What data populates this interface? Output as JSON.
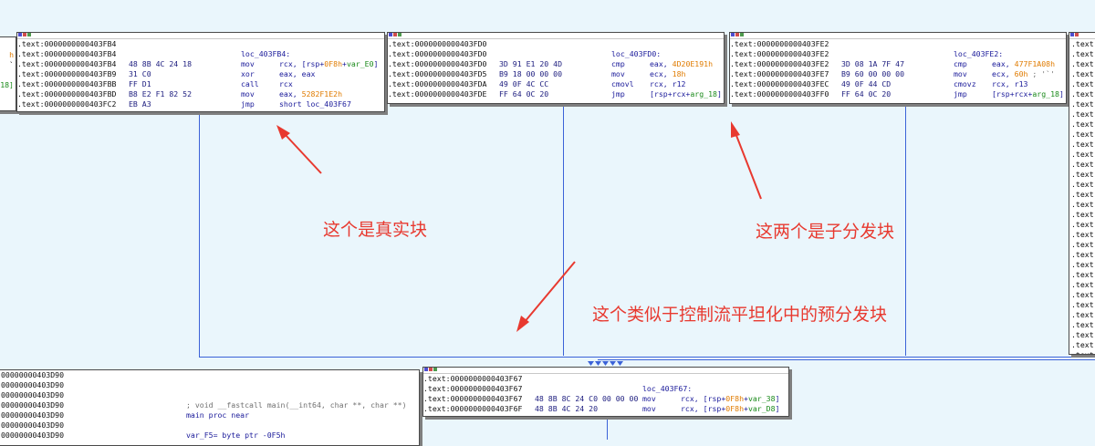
{
  "colors": {
    "background": "#eaf6fc",
    "edge": "#3b62d8",
    "annotation": "#e8392f",
    "address": "#111111",
    "mnemonic": "#1a1a9a",
    "number": "#e07b00",
    "variable": "#1a8a1a"
  },
  "icons": [
    "node-header-icon"
  ],
  "annotations": {
    "real_block": "这个是真实块",
    "child_blocks": "这两个是子分发块",
    "pre_dispatch": "这个类似于控制流平坦化中的预分发块"
  },
  "left_edge_node": {
    "lines": [
      "h",
      "`",
      "",
      "18]",
      ""
    ]
  },
  "node_fb4": {
    "lines": [
      {
        "addr": ".text:0000000000403FB4",
        "bytes": "",
        "label": "",
        "mnem": "",
        "ops": []
      },
      {
        "addr": ".text:0000000000403FB4",
        "bytes": "",
        "label": "loc_403FB4:",
        "mnem": "",
        "ops": []
      },
      {
        "addr": ".text:0000000000403FB4",
        "bytes": "48 8B 4C 24 18",
        "label": "",
        "mnem": "mov",
        "ops": [
          [
            "rcx, [rsp+",
            "op"
          ],
          [
            "0F8h",
            "num"
          ],
          [
            "+",
            "op"
          ],
          [
            "var_E0",
            "var"
          ],
          [
            "]",
            "op"
          ]
        ]
      },
      {
        "addr": ".text:0000000000403FB9",
        "bytes": "31 C0",
        "label": "",
        "mnem": "xor",
        "ops": [
          [
            "eax, eax",
            "op"
          ]
        ]
      },
      {
        "addr": ".text:0000000000403FBB",
        "bytes": "FF D1",
        "label": "",
        "mnem": "call",
        "ops": [
          [
            "rcx",
            "op"
          ]
        ]
      },
      {
        "addr": ".text:0000000000403FBD",
        "bytes": "B8 E2 F1 82 52",
        "label": "",
        "mnem": "mov",
        "ops": [
          [
            "eax, ",
            "op"
          ],
          [
            "5282F1E2h",
            "num"
          ]
        ]
      },
      {
        "addr": ".text:0000000000403FC2",
        "bytes": "EB A3",
        "label": "",
        "mnem": "jmp",
        "ops": [
          [
            "short loc_403F67",
            "op"
          ]
        ]
      }
    ]
  },
  "node_fd0": {
    "lines": [
      {
        "addr": ".text:0000000000403FD0",
        "bytes": "",
        "label": "",
        "mnem": "",
        "ops": []
      },
      {
        "addr": ".text:0000000000403FD0",
        "bytes": "",
        "label": "loc_403FD0:",
        "mnem": "",
        "ops": []
      },
      {
        "addr": ".text:0000000000403FD0",
        "bytes": "3D 91 E1 20 4D",
        "label": "",
        "mnem": "cmp",
        "ops": [
          [
            "eax, ",
            "op"
          ],
          [
            "4D20E191h",
            "num"
          ]
        ]
      },
      {
        "addr": ".text:0000000000403FD5",
        "bytes": "B9 18 00 00 00",
        "label": "",
        "mnem": "mov",
        "ops": [
          [
            "ecx, ",
            "op"
          ],
          [
            "18h",
            "num"
          ]
        ]
      },
      {
        "addr": ".text:0000000000403FDA",
        "bytes": "49 0F 4C CC",
        "label": "",
        "mnem": "cmovl",
        "ops": [
          [
            "rcx, r12",
            "op"
          ]
        ]
      },
      {
        "addr": ".text:0000000000403FDE",
        "bytes": "FF 64 0C 20",
        "label": "",
        "mnem": "jmp",
        "ops": [
          [
            "[rsp+rcx+",
            "op"
          ],
          [
            "arg_18",
            "var"
          ],
          [
            "]",
            "op"
          ]
        ]
      }
    ]
  },
  "node_fe2": {
    "lines": [
      {
        "addr": ".text:0000000000403FE2",
        "bytes": "",
        "label": "",
        "mnem": "",
        "ops": []
      },
      {
        "addr": ".text:0000000000403FE2",
        "bytes": "",
        "label": "loc_403FE2:",
        "mnem": "",
        "ops": []
      },
      {
        "addr": ".text:0000000000403FE2",
        "bytes": "3D 08 1A 7F 47",
        "label": "",
        "mnem": "cmp",
        "ops": [
          [
            "eax, ",
            "op"
          ],
          [
            "477F1A08h",
            "num"
          ]
        ]
      },
      {
        "addr": ".text:0000000000403FE7",
        "bytes": "B9 60 00 00 00",
        "label": "",
        "mnem": "mov",
        "ops": [
          [
            "ecx, ",
            "op"
          ],
          [
            "60h",
            "num"
          ],
          [
            " ; '`'",
            "com"
          ]
        ]
      },
      {
        "addr": ".text:0000000000403FEC",
        "bytes": "49 0F 44 CD",
        "label": "",
        "mnem": "cmovz",
        "ops": [
          [
            "rcx, r13",
            "op"
          ]
        ]
      },
      {
        "addr": ".text:0000000000403FF0",
        "bytes": "FF 64 0C 20",
        "label": "",
        "mnem": "jmp",
        "ops": [
          [
            "[rsp+rcx+",
            "op"
          ],
          [
            "arg_18",
            "var"
          ],
          [
            "]",
            "op"
          ]
        ]
      }
    ]
  },
  "right_edge_node": {
    "lines": [
      ".text",
      ".text",
      ".text",
      ".text",
      ".text",
      ".text",
      ".text",
      ".text",
      ".text",
      ".text",
      ".text",
      ".text",
      ".text",
      ".text",
      ".text",
      ".text",
      ".text",
      ".text",
      ".text",
      ".text",
      ".text",
      ".text",
      ".text",
      ".text",
      ".text",
      ".text",
      ".text",
      ".text",
      ".text",
      ".text",
      ".text",
      ".text"
    ]
  },
  "node_f67": {
    "lines": [
      {
        "addr": ".text:0000000000403F67",
        "bytes": "",
        "label": "",
        "mnem": "",
        "ops": []
      },
      {
        "addr": ".text:0000000000403F67",
        "bytes": "",
        "label": "loc_403F67:",
        "mnem": "",
        "ops": []
      },
      {
        "addr": ".text:0000000000403F67",
        "bytes": "48 8B 8C 24 C0 00 00 00",
        "label": "",
        "mnem": "mov",
        "ops": [
          [
            "rcx, [rsp+",
            "op"
          ],
          [
            "0F8h",
            "num"
          ],
          [
            "+",
            "op"
          ],
          [
            "var_38",
            "var"
          ],
          [
            "]",
            "op"
          ]
        ]
      },
      {
        "addr": ".text:0000000000403F6F",
        "bytes": "48 8B 4C 24 20",
        "label": "",
        "mnem": "mov",
        "ops": [
          [
            "rcx, [rsp+",
            "op"
          ],
          [
            "0F8h",
            "num"
          ],
          [
            "+",
            "op"
          ],
          [
            "var_D8",
            "var"
          ],
          [
            "]",
            "op"
          ]
        ]
      }
    ]
  },
  "node_main": {
    "lines": [
      {
        "addr": "00000000403D90",
        "text": ""
      },
      {
        "addr": "00000000403D90",
        "text": ""
      },
      {
        "addr": "00000000403D90",
        "text": ""
      },
      {
        "addr": "00000000403D90",
        "text": "; void __fastcall main(__int64, char **, char **)",
        "kind": "com"
      },
      {
        "addr": "00000000403D90",
        "text": "main proc near",
        "kind": "lbl"
      },
      {
        "addr": "00000000403D90",
        "text": ""
      },
      {
        "addr": "00000000403D90",
        "text": "var_F5= byte ptr -0F5h",
        "kind": "lbl"
      }
    ]
  }
}
